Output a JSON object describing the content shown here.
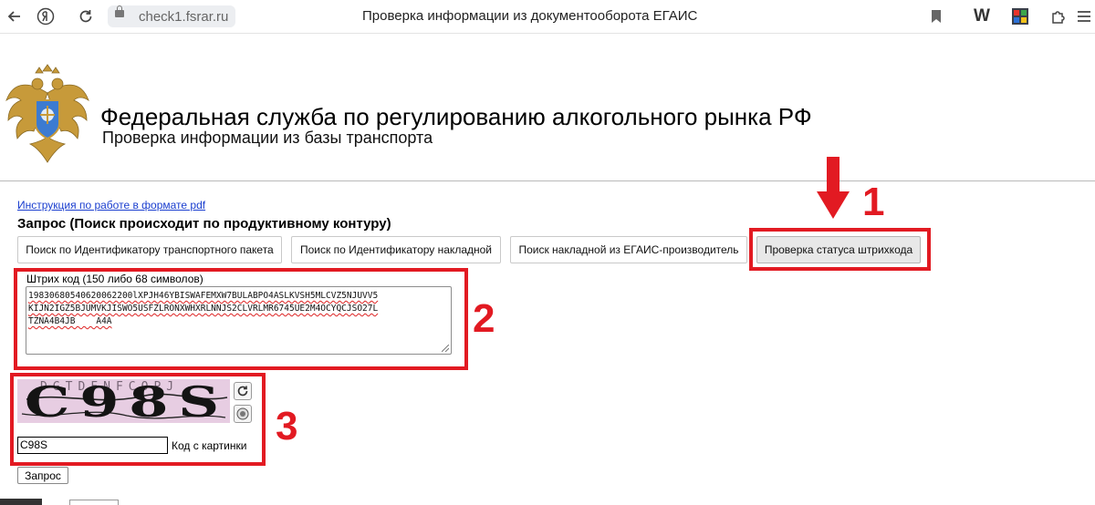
{
  "browser": {
    "url": "check1.fsrar.ru",
    "window_title": "Проверка информации из документооборота ЕГАИС",
    "icons": [
      "back-arrow-icon",
      "yandex-logo-icon",
      "reload-icon",
      "lock-icon",
      "bookmark-icon",
      "w-icon",
      "extension-icon",
      "puzzle-icon",
      "menu-icon"
    ]
  },
  "header": {
    "title": "Федеральная служба по регулированию алкогольного рынка РФ",
    "subtitle": "Проверка информации из базы транспорта"
  },
  "main": {
    "pdf_link": "Инструкция по работе в формате pdf",
    "query_title": "Запрос (Поиск происходит по продуктивному контуру)",
    "tabs": [
      {
        "label": "Поиск по Идентификатору транспортного пакета"
      },
      {
        "label": "Поиск по Идентификатору накладной"
      },
      {
        "label": "Поиск накладной из ЕГАИС-производитель"
      },
      {
        "label": "Проверка статуса штрихкода"
      }
    ],
    "barcode": {
      "label": "Штрих код (150 либо 68 символов)",
      "lines": [
        "19830680540620062200lXPJH46YBISWAFEMXW7BULABPO4ASLKVSH5MLCVZ5NJUVV5",
        "KIJN2IGZ5BJUMVKJISWO5USFZLRONXWHXRLNNJS2CLVRLMR6745UE2M4OCYQCJSO27L",
        "TZNA4B4JB    A4A"
      ]
    },
    "captcha": {
      "image_text": "C98S",
      "code_value": "C98S",
      "code_label": "Код с картинки",
      "refresh_icon": "refresh-icon",
      "audio_icon": "audio-icon"
    },
    "submit_label": "Запрос"
  },
  "annotations": {
    "numbers": [
      "1",
      "2",
      "3"
    ],
    "color": "#e21a22"
  }
}
